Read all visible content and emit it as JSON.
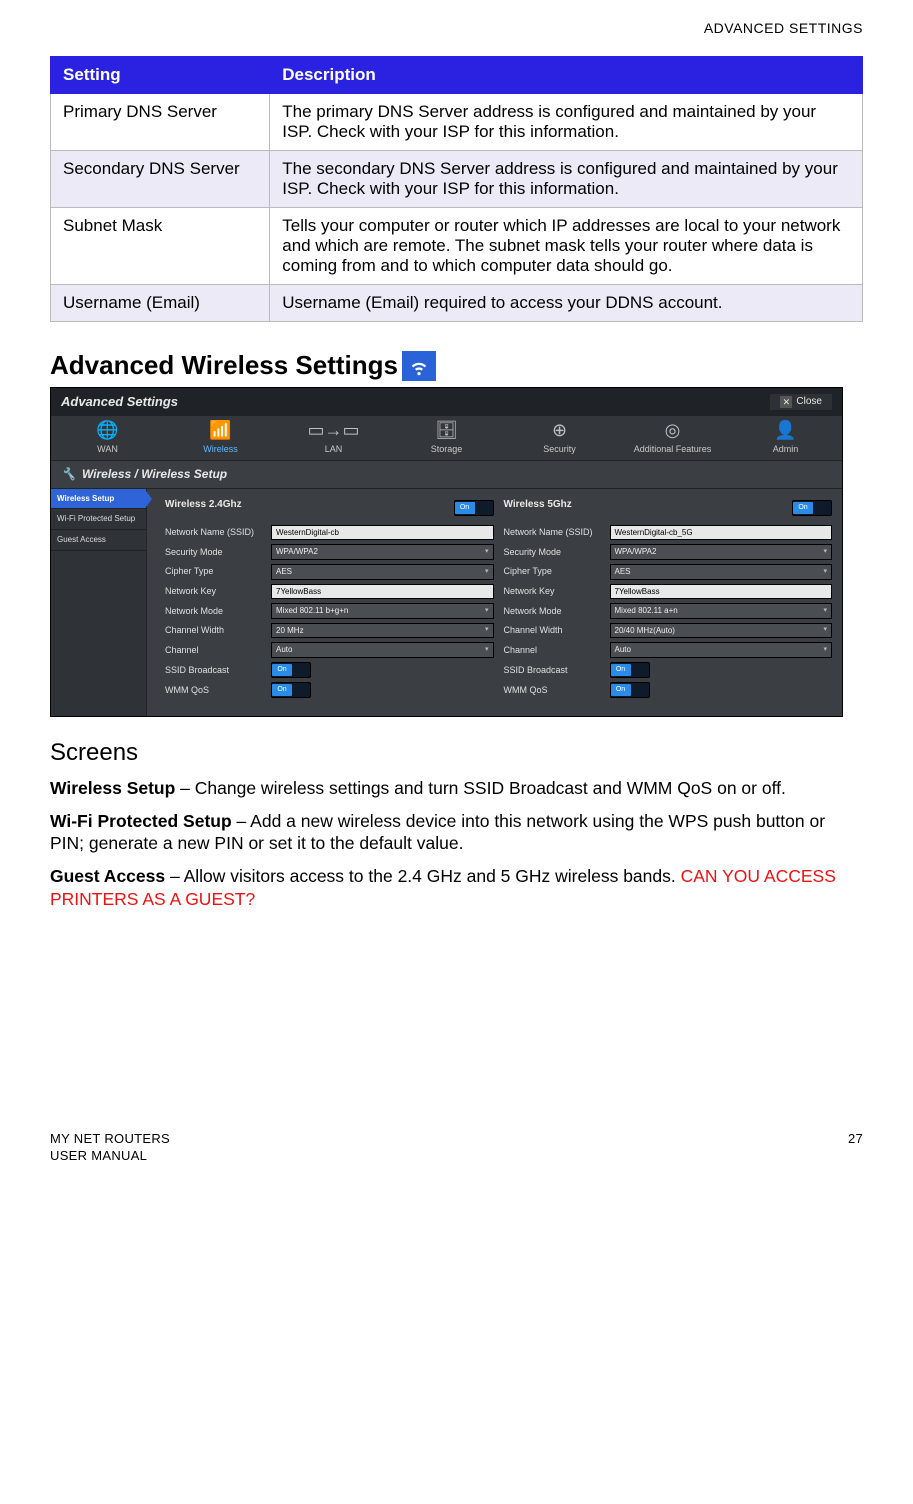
{
  "header": {
    "right": "ADVANCED SETTINGS"
  },
  "table": {
    "head": {
      "c1": "Setting",
      "c2": "Description"
    },
    "rows": [
      {
        "c1": "Primary DNS Server",
        "c2": "The primary DNS Server address is configured and maintained by your ISP. Check with your ISP for this information."
      },
      {
        "c1": "Secondary DNS Server",
        "c2": "The secondary DNS Server address is configured and maintained by your ISP. Check with your ISP for this information."
      },
      {
        "c1": "Subnet Mask",
        "c2": "Tells your computer or router which IP addresses are local to your network and which are remote. The subnet mask tells your router where data is coming from and to which computer data should go."
      },
      {
        "c1": "Username (Email)",
        "c2": "Username (Email) required to access your DDNS account."
      }
    ]
  },
  "section_title": "Advanced Wireless Settings",
  "mock": {
    "title": "Advanced Settings",
    "close": "Close",
    "tabs": [
      "WAN",
      "Wireless",
      "LAN",
      "Storage",
      "Security",
      "Additional Features",
      "Admin"
    ],
    "crumb": "Wireless / Wireless Setup",
    "side": [
      "Wireless Setup",
      "Wi-Fi Protected Setup",
      "Guest Access"
    ],
    "col24": {
      "title": "Wireless 2.4Ghz",
      "toggle": "On",
      "rows": [
        {
          "l": "Network Name (SSID)",
          "t": "input",
          "v": "WesternDigital-cb"
        },
        {
          "l": "Security Mode",
          "t": "select",
          "v": "WPA/WPA2"
        },
        {
          "l": "Cipher Type",
          "t": "select",
          "v": "AES"
        },
        {
          "l": "Network Key",
          "t": "input",
          "v": "7YellowBass"
        },
        {
          "l": "Network Mode",
          "t": "select",
          "v": "Mixed 802.11 b+g+n"
        },
        {
          "l": "Channel Width",
          "t": "select",
          "v": "20 MHz"
        },
        {
          "l": "Channel",
          "t": "select",
          "v": "Auto"
        },
        {
          "l": "SSID Broadcast",
          "t": "toggle",
          "v": "On"
        },
        {
          "l": "WMM QoS",
          "t": "toggle",
          "v": "On"
        }
      ]
    },
    "col5": {
      "title": "Wireless 5Ghz",
      "toggle": "On",
      "rows": [
        {
          "l": "Network Name (SSID)",
          "t": "input",
          "v": "WesternDigital-cb_5G"
        },
        {
          "l": "Security Mode",
          "t": "select",
          "v": "WPA/WPA2"
        },
        {
          "l": "Cipher Type",
          "t": "select",
          "v": "AES"
        },
        {
          "l": "Network Key",
          "t": "input",
          "v": "7YellowBass"
        },
        {
          "l": "Network Mode",
          "t": "select",
          "v": "Mixed 802.11 a+n"
        },
        {
          "l": "Channel Width",
          "t": "select",
          "v": "20/40 MHz(Auto)"
        },
        {
          "l": "Channel",
          "t": "select",
          "v": "Auto"
        },
        {
          "l": "SSID Broadcast",
          "t": "toggle",
          "v": "On"
        },
        {
          "l": "WMM QoS",
          "t": "toggle",
          "v": "On"
        }
      ]
    }
  },
  "screens": {
    "title": "Screens",
    "p1_bold": "Wireless Setup",
    "p1_rest": " – Change wireless settings and turn SSID Broadcast and WMM QoS on or off.",
    "p2_bold": "Wi-Fi Protected Setup",
    "p2_rest": " – Add a new wireless device into this network using the WPS push button or PIN; generate a new PIN or set it to the default value.",
    "p3_bold": "Guest Access",
    "p3_rest": " – Allow visitors access to the 2.4 GHz and 5 GHz wireless bands. ",
    "p3_red": "CAN YOU ACCESS PRINTERS AS A GUEST?"
  },
  "footer": {
    "l1": "MY NET ROUTERS",
    "l2": "USER MANUAL",
    "page": "27"
  }
}
